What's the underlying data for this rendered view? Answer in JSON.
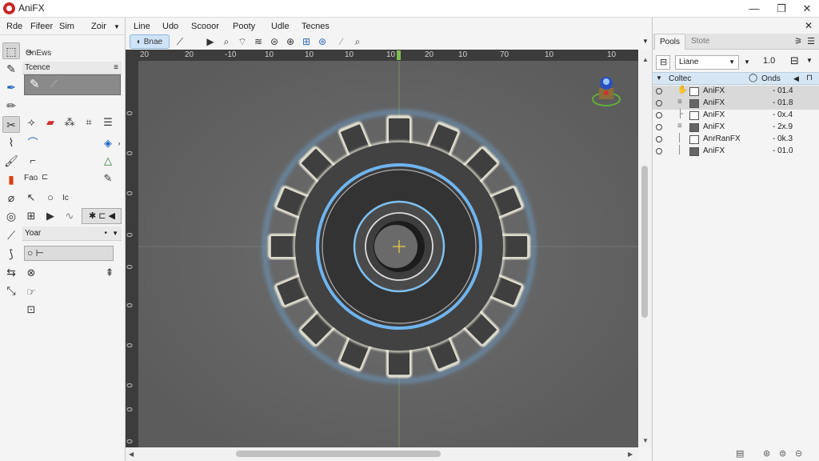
{
  "app": {
    "title": "AniFX",
    "window_controls": [
      "—",
      "❐",
      "✕"
    ]
  },
  "left_menu": [
    "Rde",
    "Fifeer",
    "Sim"
  ],
  "left_menu_extra": "Zoir",
  "left_sections": {
    "brushes": "OnEws",
    "textures": "Tcence",
    "color": "Yoar"
  },
  "left_misc": {
    "dash_icon_text": "—",
    "fourth_label": "Fao",
    "fourth_sub": "⊏",
    "small_a": "Ic"
  },
  "main_menu": [
    "Line",
    "Udo",
    "Scooor",
    "Pooty",
    "Udle",
    "Tecnes"
  ],
  "toolbar": {
    "brush_label": "Bnae"
  },
  "ruler_top": [
    "20",
    "20",
    "-10",
    "10",
    "10",
    "10",
    "10",
    "20",
    "10",
    "70",
    "10",
    "10"
  ],
  "ruler_left": [
    "0",
    "0",
    "0",
    "0",
    "0",
    "0",
    "0",
    "0",
    "0",
    "0"
  ],
  "right_panel": {
    "tabs": [
      "Pools",
      "Stote"
    ],
    "blend": "Liane",
    "opacity": "1.0",
    "group_label": "Coltec",
    "group_right": "Onds"
  },
  "layers": [
    {
      "name": "AniFX",
      "value": "- 01.4",
      "selected": true
    },
    {
      "name": "AniFX",
      "value": "- 01.8",
      "selected": true
    },
    {
      "name": "AniFX",
      "value": "- 0x.4",
      "selected": false
    },
    {
      "name": "AniFX",
      "value": "- 2x.9",
      "selected": false
    },
    {
      "name": "AnrRanFX",
      "value": "- 0k.3",
      "selected": false
    },
    {
      "name": "AniFX",
      "value": "- 01.0",
      "selected": false
    }
  ],
  "colors": {
    "accent": "#c62828",
    "canvas": "#666666",
    "glow": "#6fb4ee",
    "gear": "#3f3f3f"
  }
}
